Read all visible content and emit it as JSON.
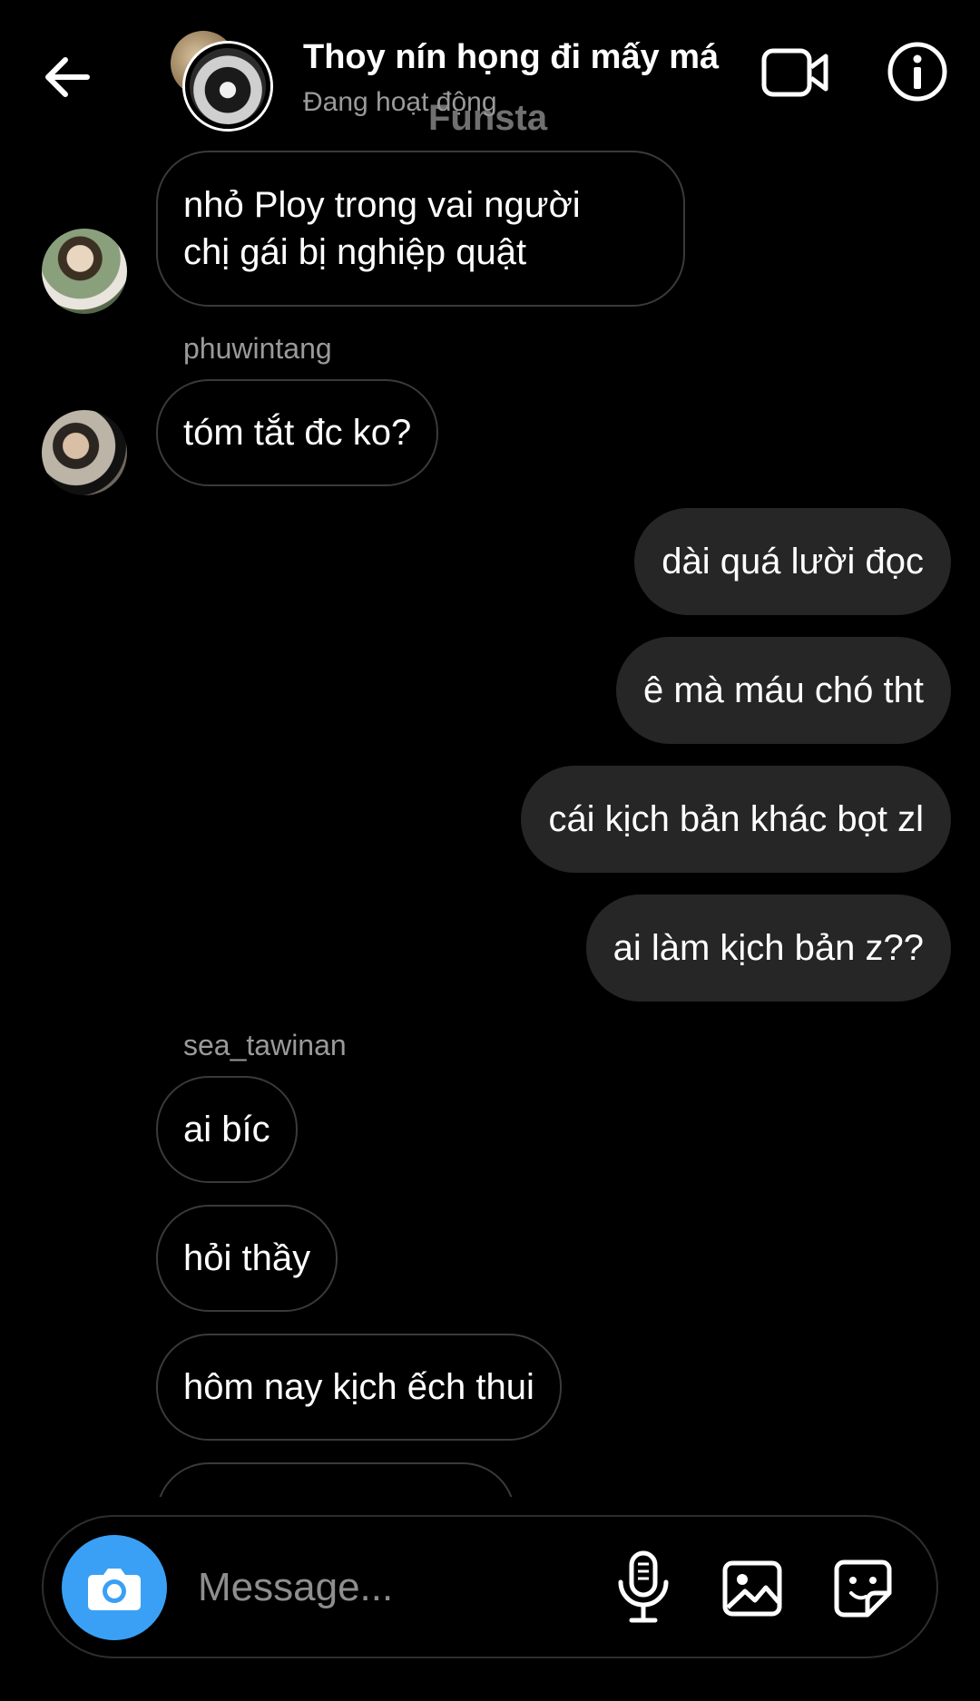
{
  "header": {
    "title": "Thoy nín họng đi mấy má",
    "status": "Đang hoạt động",
    "watermark": "Funsta",
    "icons": {
      "back": "arrow-left-icon",
      "video": "video-camera-icon",
      "info": "info-circle-icon"
    }
  },
  "messages": {
    "m1": "nhỏ Ploy trong vai người\nchị gái bị nghiệp quật",
    "sender2": "phuwintang",
    "m2": "tóm tắt đc ko?",
    "m3": "dài quá lười đọc",
    "m4": "ê mà máu chó tht",
    "m5": "cái kịch bản khác bọt zl",
    "m6": "ai làm kịch bản z??",
    "sender7": "sea_tawinan",
    "m7": "ai bíc",
    "m8": "hỏi thầy",
    "m9": "hôm nay kịch ếch thui"
  },
  "composer": {
    "placeholder": "Message...",
    "icons": {
      "camera": "camera-icon",
      "mic": "microphone-icon",
      "gallery": "image-icon",
      "sticker": "sticker-icon"
    }
  },
  "colors": {
    "background": "#000000",
    "outgoing_bubble": "#262626",
    "incoming_border": "#3a3a3a",
    "camera_button": "#3aa0f5",
    "secondary_text": "#9a9a9a"
  }
}
